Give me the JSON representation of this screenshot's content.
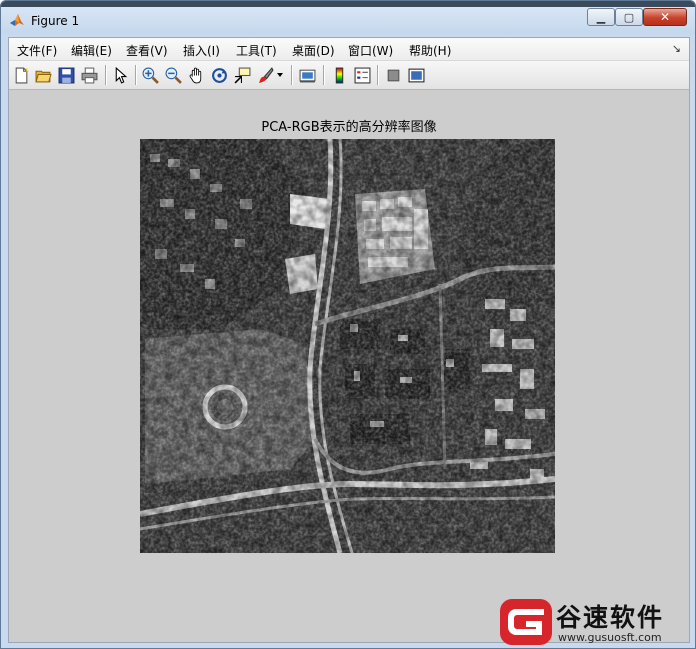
{
  "window": {
    "title": "Figure 1"
  },
  "menu": {
    "items": [
      {
        "label": "文件(F)"
      },
      {
        "label": "编辑(E)"
      },
      {
        "label": "查看(V)"
      },
      {
        "label": "插入(I)"
      },
      {
        "label": "工具(T)"
      },
      {
        "label": "桌面(D)"
      },
      {
        "label": "窗口(W)"
      },
      {
        "label": "帮助(H)"
      }
    ]
  },
  "toolbar": {
    "tools": [
      "new-figure-icon",
      "open-file-icon",
      "save-icon",
      "print-icon",
      "pointer-icon",
      "zoom-in-icon",
      "zoom-out-icon",
      "pan-hand-icon",
      "rotate-3d-icon",
      "data-cursor-icon",
      "brush-icon",
      "link-plot-icon",
      "colorbar-icon",
      "legend-icon",
      "hide-tools-icon",
      "show-tools-icon"
    ]
  },
  "figure": {
    "title": "PCA-RGB表示的高分辨率图像"
  },
  "watermark": {
    "name": "谷速软件",
    "url": "www.gusuosft.com",
    "accent": "#d7262b"
  },
  "colors": {
    "figure_bg": "#cdcdcd",
    "titlebar": "#c9daee"
  }
}
